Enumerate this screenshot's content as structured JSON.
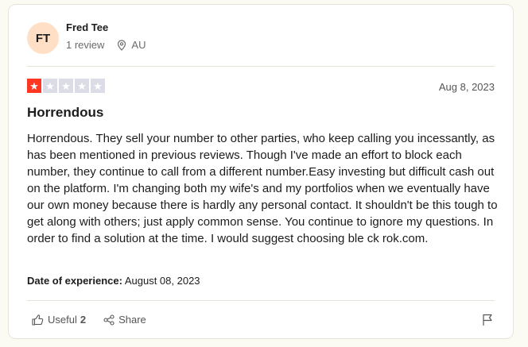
{
  "reviewer": {
    "initials": "FT",
    "name": "Fred Tee",
    "review_count": "1 review",
    "location": "AU"
  },
  "rating": {
    "stars": 1,
    "max": 5,
    "filled_color": "#ff3722",
    "empty_color": "#dcdce6"
  },
  "review": {
    "date": "Aug 8, 2023",
    "title": "Horrendous",
    "body": "Horrendous. They sell your number to other parties, who keep calling you incessantly, as has been mentioned in previous reviews. Though I've made an effort to block each number, they continue to call from a different number.Easy investing but difficult cash out on the platform. I'm changing both my wife's and my portfolios when we eventually have our own money because there is hardly any personal contact. It shouldn't be this tough to get along with others; just apply common sense. You continue to ignore my questions. In order to find a solution at the time. I would suggest choosing ble ck rok.com.",
    "experience_label": "Date of experience:",
    "experience_date": "August 08, 2023"
  },
  "actions": {
    "useful_label": "Useful",
    "useful_count": "2",
    "share_label": "Share"
  },
  "icons": {
    "location": "location-pin-icon",
    "useful": "thumbs-up-icon",
    "share": "share-icon",
    "flag": "flag-icon"
  }
}
